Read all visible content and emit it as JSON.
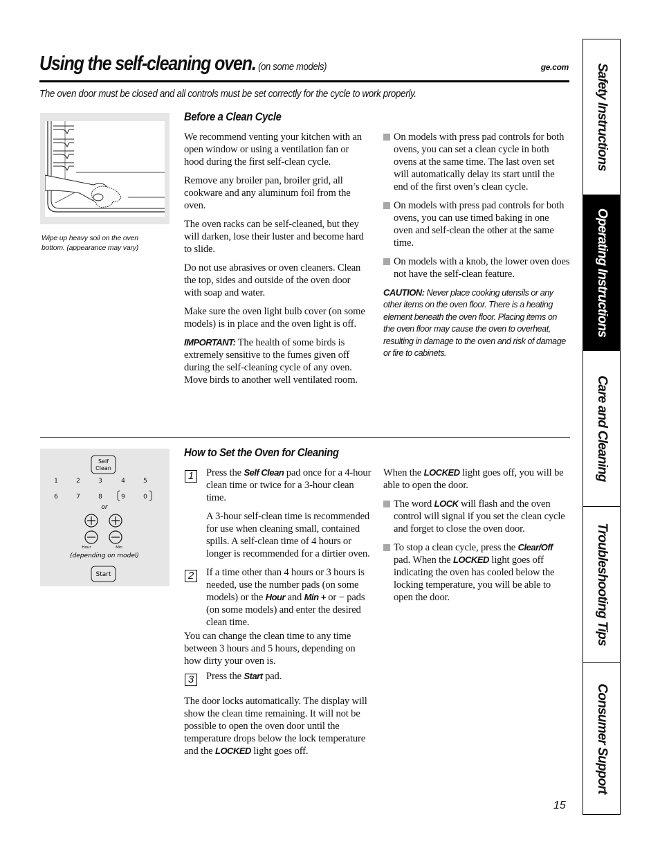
{
  "header": {
    "title": "Using the self-cleaning oven.",
    "title_note": "(on some models)",
    "site": "ge.com",
    "intro": "The oven door must be closed and all controls must be set correctly for the cycle to work properly."
  },
  "figure1": {
    "description": "Hand wiping oven bottom with cloth",
    "caption_line1": "Wipe up heavy soil on the oven",
    "caption_line2": "bottom. (appearance may vary)"
  },
  "figure2": {
    "self_clean_line1": "Self",
    "self_clean_line2": "Clean",
    "keypad_row1": [
      "1",
      "2",
      "3",
      "4",
      "5"
    ],
    "keypad_row2": [
      "6",
      "7",
      "8",
      "9",
      "0"
    ],
    "or_label": "or",
    "hour_label": "Hour",
    "min_label": "Min",
    "plus_symbol": "+",
    "minus_symbol": "−",
    "model_note": "(depending on model)",
    "start_label": "Start"
  },
  "before_clean": {
    "heading": "Before a Clean Cycle",
    "paragraphs": [
      "We recommend venting your kitchen with an open window or using a ventilation fan or hood during the first self-clean cycle.",
      "Remove any broiler pan, broiler grid, all cookware and any aluminum foil from the oven.",
      "The oven racks can be self-cleaned, but they will darken, lose their luster and become hard to slide.",
      "Do not use abrasives or oven cleaners. Clean the top, sides and outside of the oven door with soap and water.",
      "Make sure the oven light bulb cover (on some models) is in place and the oven light is off."
    ],
    "important_label": "IMPORTANT:",
    "important_text": " The health of some birds is extremely sensitive to the fumes given off during the self-cleaning cycle of any oven. Move birds to another well ventilated room.",
    "bullets": [
      "On models with press pad controls for both ovens, you can set a clean cycle in both ovens at the same time. The last oven set will automatically delay its start until the end of the first oven’s clean cycle.",
      "On models with press pad controls for both ovens, you can use timed baking in one oven and self-clean the other at the same time.",
      "On models with a knob, the lower oven does not have the self-clean feature."
    ],
    "caution_label": "CAUTION:",
    "caution_text": " Never place cooking utensils or any other items on the oven floor. There is a heating element beneath the oven floor. Placing items on the oven floor may cause the oven to overheat, resulting in damage to the oven and risk of damage or fire to cabinets."
  },
  "set_oven": {
    "heading": "How to Set the Oven for Cleaning",
    "step1": {
      "num": "1",
      "pre": "Press the ",
      "kw": "Self Clean",
      "post": " pad once for a 4-hour clean time or twice for a 3-hour clean time.",
      "note": "A 3-hour self-clean time is recommended for use when cleaning small, contained spills. A self-clean time of 4 hours or longer is recommended for a dirtier oven."
    },
    "step2": {
      "num": "2",
      "pre": "If a time other than 4 hours or 3 hours is needed, use the number pads (on some models) or the ",
      "kw1": "Hour",
      "mid": " and ",
      "kw2": "Min +",
      "post": " or − pads (on some models) and enter the desired clean time."
    },
    "change_time": "You can change the clean time to any time between 3 hours and 5 hours, depending on how dirty your oven is.",
    "step3": {
      "num": "3",
      "pre": "Press the ",
      "kw": "Start",
      "post": " pad."
    },
    "door_locks_pre": "The door locks automatically. The display will show the clean time remaining. It will not be possible to open the oven door until the temperature drops below the lock temperature and the ",
    "door_locks_kw": "LOCKED",
    "door_locks_post": " light goes off.",
    "when_locked_pre": "When the ",
    "when_locked_kw": "LOCKED",
    "when_locked_post": " light goes off, you will be able to open the door.",
    "bullet1_pre": "The word ",
    "bullet1_kw": "LOCK",
    "bullet1_post": " will flash and the oven control will signal if you set the clean cycle and forget to close the oven door.",
    "bullet2_pre": "To stop a clean cycle, press the ",
    "bullet2_kw1": "Clear/Off",
    "bullet2_mid": " pad. When the ",
    "bullet2_kw2": "LOCKED",
    "bullet2_post": " light goes off indicating the oven has cooled below the locking temperature, you will be able to open the door."
  },
  "page_number": "15",
  "side_tabs": [
    {
      "label": "Safety Instructions",
      "active": false
    },
    {
      "label": "Operating Instructions",
      "active": true
    },
    {
      "label": "Care and Cleaning",
      "active": false
    },
    {
      "label": "Troubleshooting Tips",
      "active": false
    },
    {
      "label": "Consumer Support",
      "active": false
    }
  ],
  "colors": {
    "figure_background": "#e6e6e6",
    "bullet_square": "#a8a8a8",
    "active_tab": "#000000"
  }
}
